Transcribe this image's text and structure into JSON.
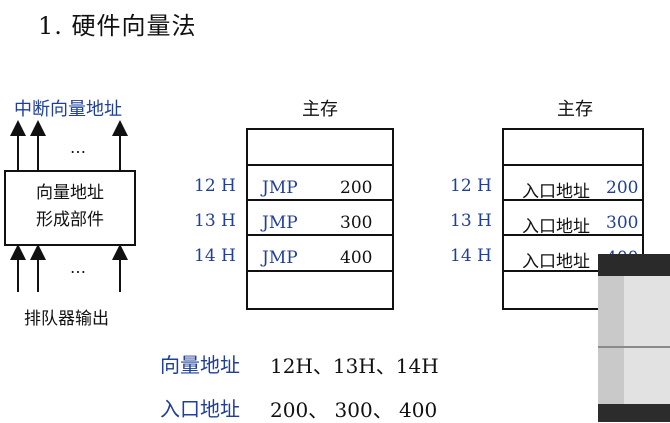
{
  "title": "1. 硬件向量法",
  "left": {
    "top_label": "中断向量地址",
    "box_line1": "向量地址",
    "box_line2": "形成部件",
    "dots": "…",
    "bottom_label": "排队器输出"
  },
  "mem1": {
    "header": "主存",
    "rows": [
      {
        "addr": "12 H",
        "op": "JMP",
        "val": "200"
      },
      {
        "addr": "13 H",
        "op": "JMP",
        "val": "300"
      },
      {
        "addr": "14 H",
        "op": "JMP",
        "val": "400"
      }
    ]
  },
  "mem2": {
    "header": "主存",
    "rows": [
      {
        "addr": "12 H",
        "text": "入口地址",
        "val": "200"
      },
      {
        "addr": "13 H",
        "text": "入口地址",
        "val": "300"
      },
      {
        "addr": "14 H",
        "text": "入口地址",
        "val": "400"
      }
    ]
  },
  "bottom": {
    "vector_label": "向量地址",
    "vector_values": "12H、13H、14H",
    "entry_label": "入口地址",
    "entry_values": "200、 300、 400"
  },
  "colors": {
    "accent_blue": "#1f3f9a",
    "text": "#111111"
  }
}
